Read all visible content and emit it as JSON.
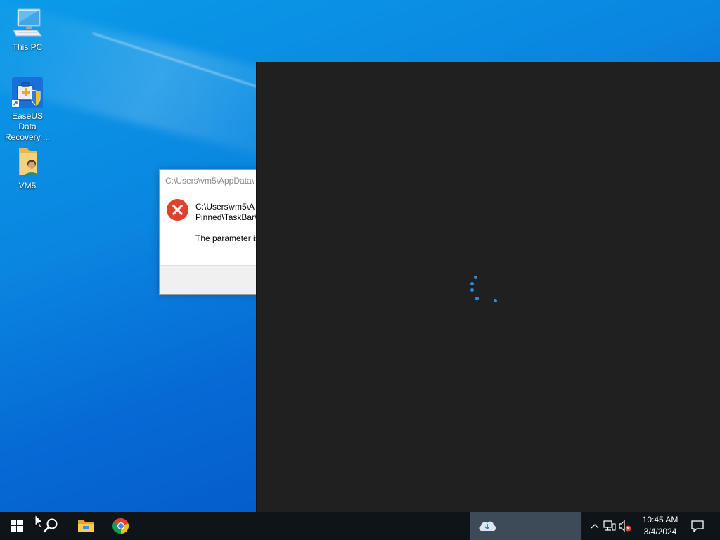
{
  "desktop": {
    "icons": [
      {
        "label": "This PC",
        "icon": "computer-icon"
      },
      {
        "label": "EaseUS Data Recovery ...",
        "icon": "easeus-icon"
      },
      {
        "label": "VM5",
        "icon": "user-folder-icon"
      }
    ]
  },
  "dialog": {
    "title": "C:\\Users\\vm5\\AppData\\",
    "message_line1": "C:\\Users\\vm5\\A",
    "message_line2": "Pinned\\TaskBar\\",
    "message_line3": "The parameter is",
    "icon": "error-icon"
  },
  "loading_window": {
    "spinner": "loading-dots"
  },
  "taskbar": {
    "start": "windows-logo-icon",
    "search": "search-icon",
    "pinned": [
      "file-explorer-icon",
      "chrome-icon"
    ],
    "active_app": "onedrive-cloud-icon",
    "tray": [
      "chevron-up-icon",
      "network-icon",
      "volume-muted-icon"
    ],
    "time": "10:45 AM",
    "date": "3/4/2024",
    "notifications": "action-center-icon"
  },
  "colors": {
    "desktop_blue": "#0a86e0",
    "taskbar": "#0f1419",
    "error_red": "#e0412c",
    "spinner_blue": "#2a8fe0",
    "dark_window": "#202020"
  }
}
